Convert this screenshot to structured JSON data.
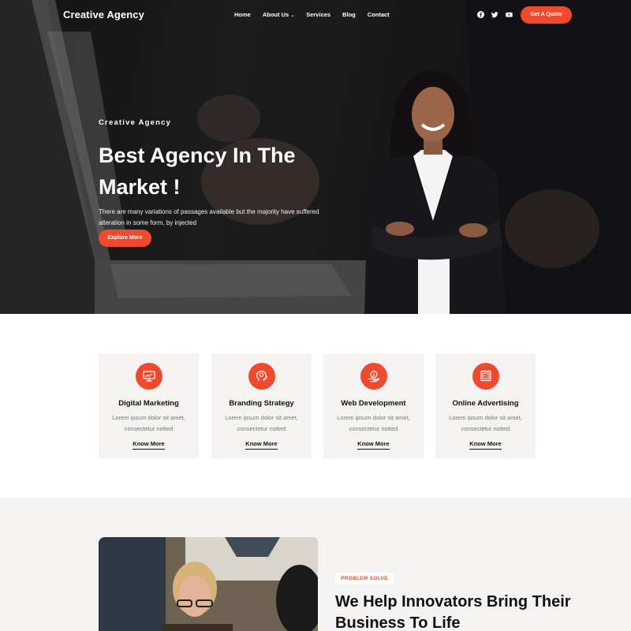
{
  "nav": {
    "brand": "Creative Agency",
    "items": [
      {
        "label": "Home"
      },
      {
        "label": "About Us",
        "has_dropdown": true
      },
      {
        "label": "Services"
      },
      {
        "label": "Blog"
      },
      {
        "label": "Contact"
      }
    ],
    "socials": [
      "facebook-icon",
      "twitter-icon",
      "youtube-icon"
    ],
    "cta": "Get A Quote"
  },
  "hero": {
    "eyebrow": "Creative Agency",
    "headline": "Best Agency In The Market !",
    "lead": "There are many variations of passages available but the majority have suffered alteration in some form, by injected",
    "button": "Explore More"
  },
  "services": [
    {
      "title": "Digital Marketing",
      "text": "Lorem ipsum dolor sit amet, consectetur notted",
      "link": "Know More",
      "icon": "monitor-chart-icon"
    },
    {
      "title": "Branding Strategy",
      "text": "Lorem ipsum dolor sit amet, consectetur notted",
      "link": "Know More",
      "icon": "head-idea-icon"
    },
    {
      "title": "Web Development",
      "text": "Lorem ipsum dolor sit amet, consectetur notted",
      "link": "Know More",
      "icon": "hand-coin-icon"
    },
    {
      "title": "Online Advertising",
      "text": "Lorem ipsum dolor sit amet, consectetur notted",
      "link": "Know More",
      "icon": "ad-board-icon"
    }
  ],
  "about": {
    "tag": "PROBLEM SOLVE",
    "title": "We Help Innovators Bring Their Business To Life"
  },
  "colors": {
    "accent": "#f0492d",
    "card_bg": "#f4f3f1",
    "section_bg": "#f4f3f1"
  }
}
